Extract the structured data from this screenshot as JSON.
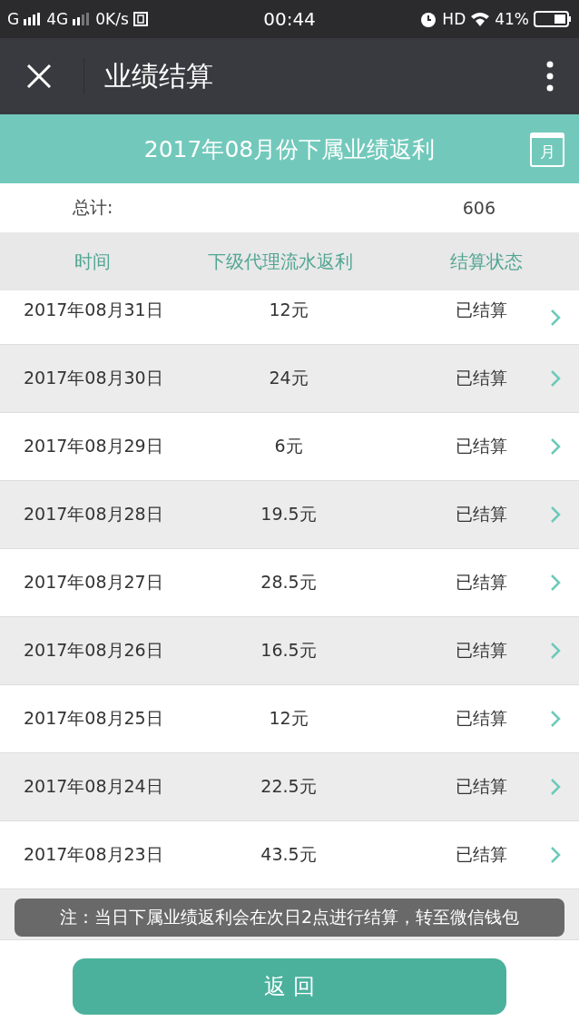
{
  "status_bar": {
    "network_1": "G",
    "network_2": "4G",
    "speed": "0K/s",
    "time": "00:44",
    "hd": "HD",
    "battery": "41%"
  },
  "nav": {
    "title": "业绩结算"
  },
  "banner": {
    "title": "2017年08月份下属业绩返利",
    "calendar_label": "月"
  },
  "total": {
    "label": "总计:",
    "value": "606"
  },
  "table": {
    "columns": [
      "时间",
      "下级代理流水返利",
      "结算状态"
    ],
    "rows": [
      {
        "date": "2017年08月31日",
        "amount": "12元",
        "status": "已结算"
      },
      {
        "date": "2017年08月30日",
        "amount": "24元",
        "status": "已结算"
      },
      {
        "date": "2017年08月29日",
        "amount": "6元",
        "status": "已结算"
      },
      {
        "date": "2017年08月28日",
        "amount": "19.5元",
        "status": "已结算"
      },
      {
        "date": "2017年08月27日",
        "amount": "28.5元",
        "status": "已结算"
      },
      {
        "date": "2017年08月26日",
        "amount": "16.5元",
        "status": "已结算"
      },
      {
        "date": "2017年08月25日",
        "amount": "12元",
        "status": "已结算"
      },
      {
        "date": "2017年08月24日",
        "amount": "22.5元",
        "status": "已结算"
      },
      {
        "date": "2017年08月23日",
        "amount": "43.5元",
        "status": "已结算"
      }
    ]
  },
  "toast": "注：当日下属业绩返利会在次日2点进行结算，转至微信钱包",
  "back_button": "返 回"
}
